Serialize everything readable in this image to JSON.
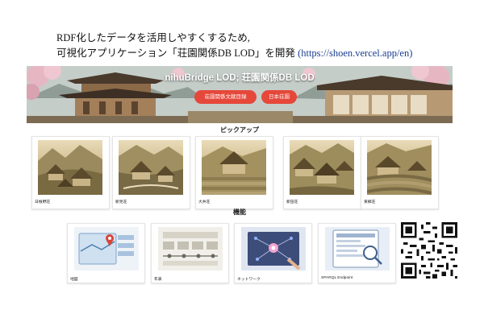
{
  "caption": {
    "line1": "RDF化したデータを活用しやすくするため,",
    "line2_text": "可視化アプリケーション「荘園関係DB LOD」を開発 ",
    "line2_url": "(https://shoen.vercel.app/en)"
  },
  "hero": {
    "title": "nihuBridge LOD; 荘園関係DB LOD",
    "buttons": [
      "荘園関係文献目録",
      "日本荘園"
    ]
  },
  "pickup": {
    "heading": "ピックアップ",
    "items": [
      "日根野荘",
      "新見荘",
      "大井荘",
      "新田荘",
      "東郷荘"
    ]
  },
  "features": {
    "heading": "機能",
    "items": [
      "地図",
      "年表",
      "ネットワーク",
      "SPARQL Endpoint"
    ]
  },
  "colors": {
    "accent_button": "#e5483a",
    "link": "#1a3d8f"
  },
  "icons": [
    "temple-illustration",
    "village-illustration",
    "map-icon",
    "timeline-icon",
    "network-icon",
    "sparql-icon",
    "qr-code"
  ]
}
